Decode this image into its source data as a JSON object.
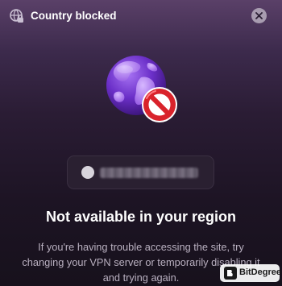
{
  "header": {
    "title": "Country blocked",
    "icon": "globe-lock-icon",
    "close_icon": "close-icon"
  },
  "illustration": {
    "icon": "blocked-globe-icon"
  },
  "site": {
    "favicon_icon": "site-favicon-icon",
    "url": ""
  },
  "main": {
    "headline": "Not available in your region",
    "message": "If you're having trouble accessing the site, try changing your VPN server or temporarily disabling it and trying again."
  },
  "watermark": {
    "text": "BitDegree",
    "icon": "bitdegree-logo-icon"
  },
  "colors": {
    "background_top": "#5a4068",
    "background_bottom": "#17111c",
    "globe_purple": "#7a3fd6",
    "block_red": "#d9232b"
  }
}
